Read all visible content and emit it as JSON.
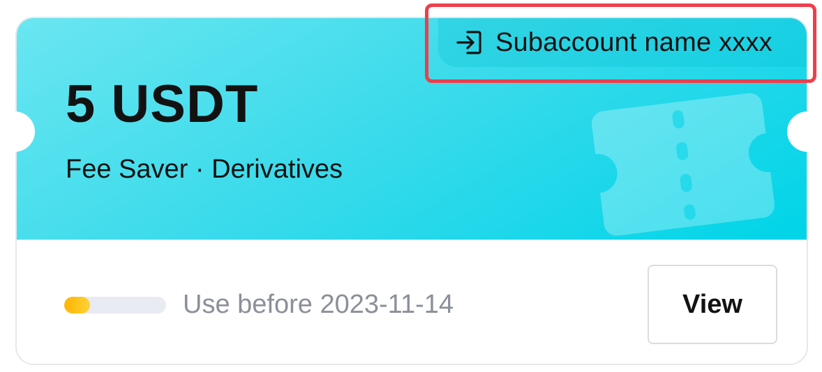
{
  "voucher": {
    "amount": "5 USDT",
    "subtitle": "Fee Saver · Derivatives",
    "subaccount": {
      "label": "Subaccount name xxxx",
      "icon": "login-arrow-icon"
    },
    "expiry_text": "Use before 2023-11-14",
    "progress_fraction": 0.25,
    "view_button_label": "View",
    "decoration_icon": "ticket-icon"
  },
  "colors": {
    "banner_start": "#6ae6f1",
    "banner_end": "#00d4e8",
    "highlight": "#ef3e4a",
    "progress_fill": "#ffb400",
    "progress_track": "#e8ebf1",
    "text_primary": "#121212",
    "text_muted": "#8a8f99"
  }
}
